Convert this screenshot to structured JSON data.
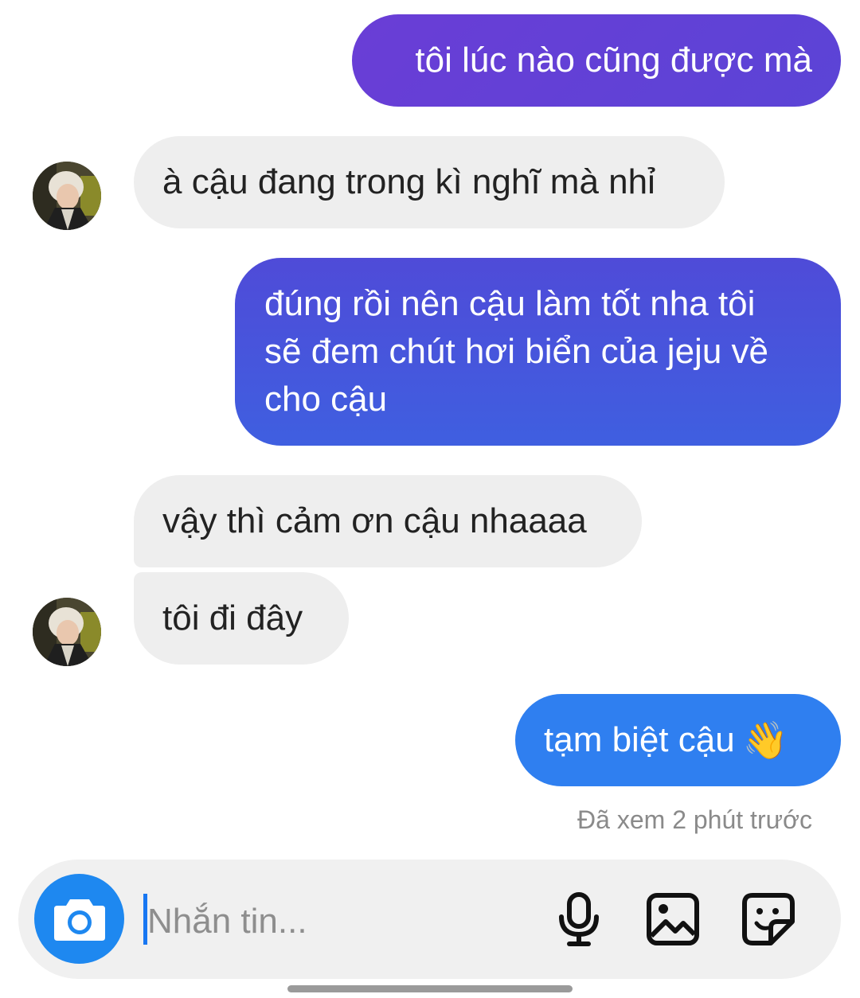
{
  "messages": [
    {
      "direction": "outgoing",
      "text": "tôi lúc nào cũng được mà"
    },
    {
      "direction": "incoming",
      "text": "à cậu đang trong kì nghĩ mà nhỉ"
    },
    {
      "direction": "outgoing",
      "lines": [
        "đúng rồi nên cậu làm tốt nha tôi",
        "sẽ đem chút hơi biển của jeju về",
        "cho cậu"
      ]
    },
    {
      "direction": "incoming",
      "text": "vậy thì cảm ơn cậu nhaaaa"
    },
    {
      "direction": "incoming",
      "text": "tôi đi đây"
    },
    {
      "direction": "outgoing",
      "text": "tạm biệt cậu",
      "emoji": "👋"
    }
  ],
  "seen_status": "Đã xem 2 phút trước",
  "composer": {
    "placeholder": "Nhắn tin...",
    "icons": [
      "camera-icon",
      "microphone-icon",
      "gallery-icon",
      "sticker-icon"
    ]
  },
  "colors": {
    "outgoing_purple": "#6a3dd6",
    "outgoing_indigo": "#4f4bd8",
    "outgoing_blue": "#2f7ff0",
    "incoming_bubble": "#eeeeee",
    "camera_button": "#1e88f0",
    "caret": "#1877f2"
  }
}
